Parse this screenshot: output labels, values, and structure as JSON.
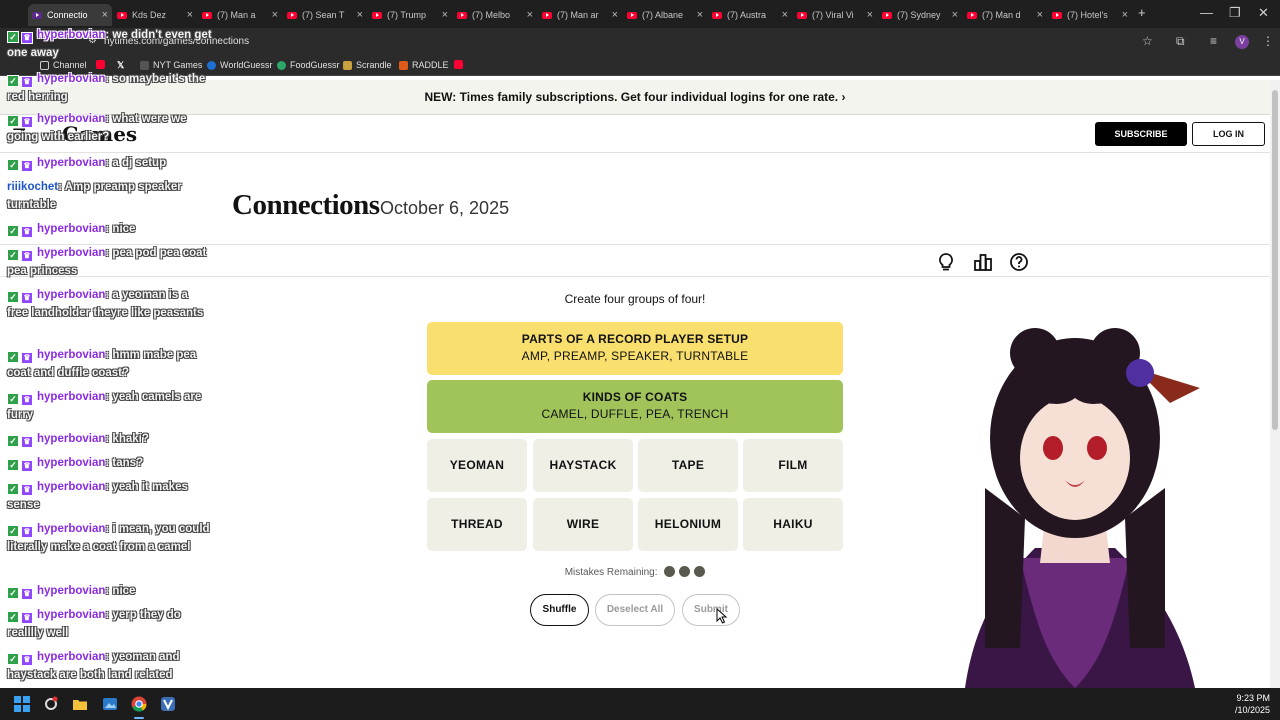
{
  "browser": {
    "tabs": [
      {
        "label": "Connectio"
      },
      {
        "label": "Kds Dez"
      },
      {
        "label": "(7) Man a"
      },
      {
        "label": "(7) Sean T"
      },
      {
        "label": "(7) Trump"
      },
      {
        "label": "(7) Melbo"
      },
      {
        "label": "(7) Man ar"
      },
      {
        "label": "(7) Albane"
      },
      {
        "label": "(7) Austra"
      },
      {
        "label": "(7) Viral Vi"
      },
      {
        "label": "(7) Sydney"
      },
      {
        "label": "(7) Man d"
      },
      {
        "label": "(7) Hotel's"
      }
    ],
    "new_tab": "+",
    "url": "nytimes.com/games/connections",
    "profile_initial": "V",
    "bookmarks": [
      {
        "label": "Channel"
      },
      {
        "label": "NYT Games"
      },
      {
        "label": "WorldGuessr"
      },
      {
        "label": "FoodGuessr"
      },
      {
        "label": "Scrandle"
      },
      {
        "label": "RADDLE"
      }
    ]
  },
  "nyt": {
    "banner": "NEW: Times family subscriptions. Get four individual logins for one rate. ›",
    "logo": "Games",
    "subscribe": "SUBSCRIBE",
    "login": "LOG IN",
    "title": "Connections",
    "date": "October 6, 2025",
    "instructions": "Create four groups of four!",
    "solved": [
      {
        "category": "PARTS OF A RECORD PLAYER SETUP",
        "words": "AMP, PREAMP, SPEAKER, TURNTABLE",
        "color": "#f9df6d"
      },
      {
        "category": "KINDS OF COATS",
        "words": "CAMEL, DUFFLE, PEA, TRENCH",
        "color": "#a0c35a"
      }
    ],
    "tiles": [
      "YEOMAN",
      "HAYSTACK",
      "TAPE",
      "FILM",
      "THREAD",
      "WIRE",
      "HELONIUM",
      "HAIKU"
    ],
    "mistakes_label": "Mistakes Remaining:",
    "mistakes_remaining": 3,
    "buttons": {
      "shuffle": "Shuffle",
      "deselect": "Deselect All",
      "submit": "Submit"
    }
  },
  "chat": [
    {
      "user": "hyperbovian",
      "text": "we didn't even get one away"
    },
    {
      "user": "hyperbovian",
      "text": "so maybe it's the red herring"
    },
    {
      "user": "hyperbovian",
      "text": "what were we going with earlier?"
    },
    {
      "user": "hyperbovian",
      "text": "a dj setup"
    },
    {
      "user": "riiikochet",
      "text": "Amp preamp speaker turntable"
    },
    {
      "user": "hyperbovian",
      "text": "nice"
    },
    {
      "user": "hyperbovian",
      "text": "pea pod pea coat pea princess"
    },
    {
      "user": "hyperbovian",
      "text": "a yeoman is a free landholder theyre like peasants"
    },
    {
      "user": "hyperbovian",
      "text": "hmm mabe pea coat and duffle coast?"
    },
    {
      "user": "hyperbovian",
      "text": "yeah camels are furry"
    },
    {
      "user": "hyperbovian",
      "text": "khaki?"
    },
    {
      "user": "hyperbovian",
      "text": "tans?"
    },
    {
      "user": "hyperbovian",
      "text": "yeah it makes sense"
    },
    {
      "user": "hyperbovian",
      "text": "i mean, you could literally make a coat from a camel"
    },
    {
      "user": "hyperbovian",
      "text": "nice"
    },
    {
      "user": "hyperbovian",
      "text": "yerp they do realllly well"
    },
    {
      "user": "hyperbovian",
      "text": "yeoman and haystack are both land related"
    }
  ],
  "taskbar": {
    "time": "9:23 PM",
    "date": "/10/2025"
  },
  "colors": {
    "yellow_group": "#f9df6d",
    "green_group": "#a0c35a",
    "tile_bg": "#efefe6",
    "mistake_dot": "#5a594e"
  }
}
